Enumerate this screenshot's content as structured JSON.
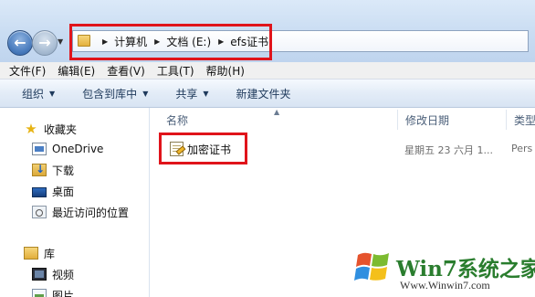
{
  "addressbar": {
    "crumbs": [
      "计算机",
      "文档 (E:)",
      "efs证书"
    ]
  },
  "menubar": {
    "items": [
      "文件(F)",
      "编辑(E)",
      "查看(V)",
      "工具(T)",
      "帮助(H)"
    ]
  },
  "commandbar": {
    "items": [
      "组织",
      "包含到库中",
      "共享",
      "新建文件夹"
    ]
  },
  "sidebar": {
    "favorites_label": "收藏夹",
    "favorites": [
      "OneDrive",
      "下载",
      "桌面",
      "最近访问的位置"
    ],
    "libraries_label": "库",
    "libraries": [
      "视频",
      "图片"
    ]
  },
  "columns": {
    "name": "名称",
    "date": "修改日期",
    "type": "类型"
  },
  "files": [
    {
      "name": "加密证书",
      "date": "星期五 23 六月 1...",
      "type": "Pers"
    }
  ],
  "watermark": {
    "brand": "Win7系统之家",
    "url": "Www.Winwin7.com"
  },
  "colors": {
    "highlight": "#e0141b",
    "watermark_green": "#2a7d2e"
  }
}
